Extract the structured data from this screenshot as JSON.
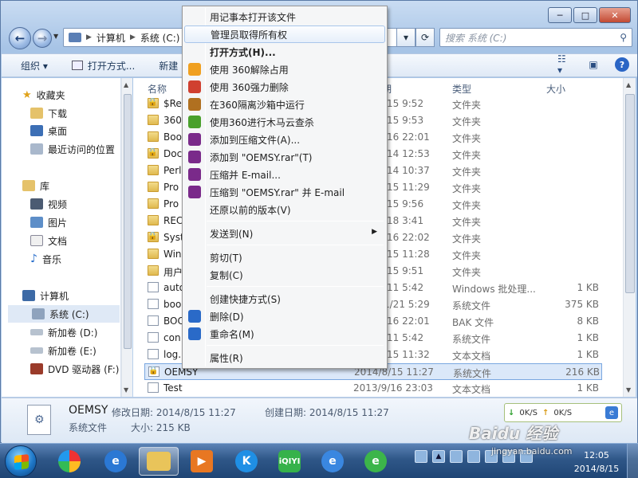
{
  "window": {
    "min_label": "─",
    "max_label": "□",
    "close_label": "✕"
  },
  "address": {
    "parts": [
      "计算机",
      "系统 (C:)"
    ],
    "search_placeholder": "搜索 系统 (C:)"
  },
  "toolbar": {
    "organize": "组织 ▾",
    "open_with": "打开方式...",
    "new": "新建"
  },
  "sidebar": {
    "favorites": "收藏夹",
    "downloads": "下载",
    "desktop": "桌面",
    "recent": "最近访问的位置",
    "libraries": "库",
    "videos": "视频",
    "pictures": "图片",
    "documents": "文档",
    "music": "音乐",
    "computer": "计算机",
    "drive_c": "系统 (C:)",
    "drive_d": "新加卷 (D:)",
    "drive_e": "新加卷 (E:)",
    "drive_f": "DVD 驱动器 (F:)"
  },
  "columns": {
    "name": "名称",
    "date": "期",
    "type": "类型",
    "size": "大小"
  },
  "rows": [
    {
      "name": "$Re",
      "date": "/15 9:52",
      "type": "文件夹",
      "size": ""
    },
    {
      "name": "360",
      "date": "/15 9:53",
      "type": "文件夹",
      "size": ""
    },
    {
      "name": "Boo",
      "date": "/16 22:01",
      "type": "文件夹",
      "size": ""
    },
    {
      "name": "Doc",
      "date": "/14 12:53",
      "type": "文件夹",
      "size": ""
    },
    {
      "name": "Perl",
      "date": "/14 10:37",
      "type": "文件夹",
      "size": ""
    },
    {
      "name": "Pro",
      "date": "/15 11:29",
      "type": "文件夹",
      "size": ""
    },
    {
      "name": "Pro",
      "date": "/15 9:56",
      "type": "文件夹",
      "size": ""
    },
    {
      "name": "REC",
      "date": "/18 3:41",
      "type": "文件夹",
      "size": ""
    },
    {
      "name": "Syst",
      "date": "/16 22:02",
      "type": "文件夹",
      "size": ""
    },
    {
      "name": "Win",
      "date": "/15 11:28",
      "type": "文件夹",
      "size": ""
    },
    {
      "name": "用户",
      "date": "/15 9:51",
      "type": "文件夹",
      "size": ""
    },
    {
      "name": "auto",
      "date": "/11 5:42",
      "type": "Windows 批处理...",
      "size": "1 KB"
    },
    {
      "name": "boo",
      "date": "1/21 5:29",
      "type": "系统文件",
      "size": "375 KB"
    },
    {
      "name": "BOC",
      "date": "/16 22:01",
      "type": "BAK 文件",
      "size": "8 KB"
    },
    {
      "name": "con",
      "date": "/11 5:42",
      "type": "系统文件",
      "size": "1 KB"
    },
    {
      "name": "log.",
      "date": "/15 11:32",
      "type": "文本文档",
      "size": "1 KB"
    },
    {
      "name": "OEMSY",
      "date": "2014/8/15 11:27",
      "type": "系统文件",
      "size": "216 KB"
    },
    {
      "name": "Test",
      "date": "2013/9/16 23:03",
      "type": "文本文档",
      "size": "1 KB"
    }
  ],
  "menu": {
    "items": [
      "用记事本打开该文件",
      "管理员取得所有权",
      "打开方式(H)...",
      "使用 360解除占用",
      "使用 360强力删除",
      "在360隔离沙箱中运行",
      "使用360进行木马云查杀",
      "添加到压缩文件(A)...",
      "添加到 \"OEMSY.rar\"(T)",
      "压缩并 E-mail...",
      "压缩到 \"OEMSY.rar\" 并 E-mail",
      "还原以前的版本(V)",
      "发送到(N)",
      "剪切(T)",
      "复制(C)",
      "创建快捷方式(S)",
      "删除(D)",
      "重命名(M)",
      "属性(R)"
    ]
  },
  "details": {
    "name": "OEMSY",
    "modified": "修改日期: 2014/8/15 11:27",
    "created": "创建日期: 2014/8/15 11:27",
    "type": "系统文件",
    "size": "大小: 215 KB"
  },
  "speed": {
    "down": "0K/S",
    "up": "0K/S"
  },
  "taskbar": {
    "time": "12:05",
    "date": "2014/8/15"
  },
  "watermark": {
    "logo": "Baidu 经验",
    "url": "jingyan.baidu.com"
  },
  "colors": {
    "accent": "#2a65c5",
    "selection": "#dbe8f9",
    "taskbar": "#2f5788"
  }
}
